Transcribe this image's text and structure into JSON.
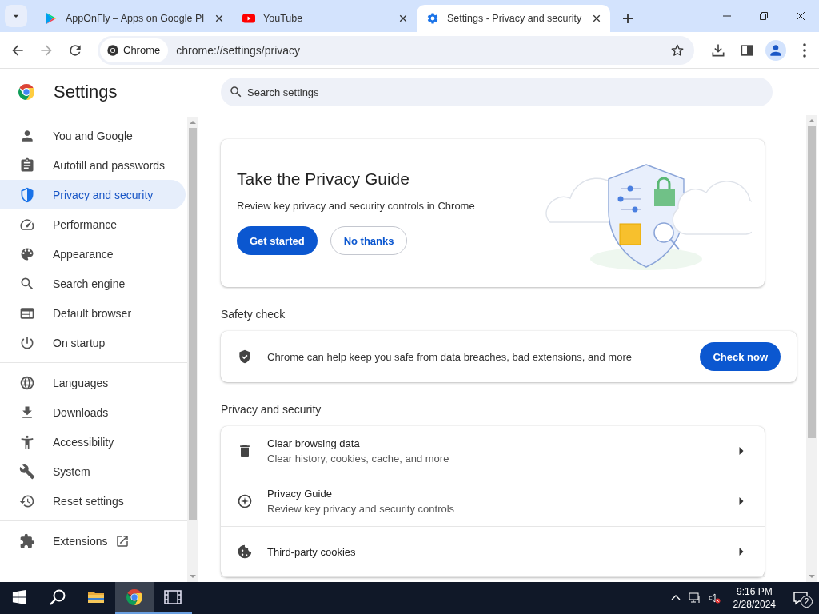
{
  "tabs": [
    {
      "title": "AppOnFly – Apps on Google Pl",
      "kind": "play",
      "selected": false
    },
    {
      "title": "YouTube",
      "kind": "youtube",
      "selected": false
    },
    {
      "title": "Settings - Privacy and security",
      "kind": "gear",
      "selected": true
    }
  ],
  "address_bar": {
    "chip": "Chrome",
    "url": "chrome://settings/privacy"
  },
  "sidebar": {
    "title": "Settings",
    "groups": [
      [
        {
          "label": "You and Google",
          "kind": "person",
          "selected": false
        },
        {
          "label": "Autofill and passwords",
          "kind": "clipboard",
          "selected": false
        },
        {
          "label": "Privacy and security",
          "kind": "shield",
          "selected": true
        },
        {
          "label": "Performance",
          "kind": "gauge",
          "selected": false
        },
        {
          "label": "Appearance",
          "kind": "palette",
          "selected": false
        },
        {
          "label": "Search engine",
          "kind": "search",
          "selected": false
        },
        {
          "label": "Default browser",
          "kind": "browser",
          "selected": false
        },
        {
          "label": "On startup",
          "kind": "power",
          "selected": false
        }
      ],
      [
        {
          "label": "Languages",
          "kind": "globe",
          "selected": false
        },
        {
          "label": "Downloads",
          "kind": "download",
          "selected": false
        },
        {
          "label": "Accessibility",
          "kind": "accessibility",
          "selected": false
        },
        {
          "label": "System",
          "kind": "wrench",
          "selected": false
        },
        {
          "label": "Reset settings",
          "kind": "history",
          "selected": false
        }
      ],
      [
        {
          "label": "Extensions",
          "kind": "puzzle",
          "selected": false,
          "external": true
        }
      ]
    ]
  },
  "search": {
    "placeholder": "Search settings"
  },
  "privacy_guide_card": {
    "title": "Take the Privacy Guide",
    "description": "Review key privacy and security controls in Chrome",
    "buttons": [
      {
        "label": "Get started",
        "kind": "primary"
      },
      {
        "label": "No thanks",
        "kind": "secondary"
      }
    ]
  },
  "safety_check": {
    "heading": "Safety check",
    "text": "Chrome can help keep you safe from data breaches, bad extensions, and more",
    "button": "Check now"
  },
  "privacy_section": {
    "heading": "Privacy and security",
    "rows": [
      {
        "title": "Clear browsing data",
        "subtitle": "Clear history, cookies, cache, and more",
        "kind": "trash"
      },
      {
        "title": "Privacy Guide",
        "subtitle": "Review key privacy and security controls",
        "kind": "compass"
      },
      {
        "title": "Third-party cookies",
        "kind": "cookie"
      }
    ]
  },
  "taskbar": {
    "apps": [
      {
        "kind": "folder",
        "selected": false,
        "running": false
      },
      {
        "kind": "chrome",
        "selected": true,
        "running": true
      },
      {
        "kind": "film",
        "selected": false,
        "running": true
      }
    ],
    "time": "9:16 PM",
    "date": "2/28/2024",
    "notifications": "2"
  }
}
